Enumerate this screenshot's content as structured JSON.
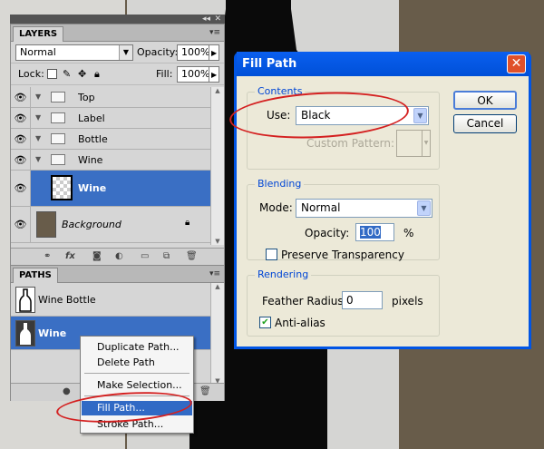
{
  "layers_panel": {
    "tab": "LAYERS",
    "blend_mode": "Normal",
    "opacity_label": "Opacity:",
    "opacity_value": "100%",
    "lock_label": "Lock:",
    "fill_label": "Fill:",
    "fill_value": "100%",
    "layers": [
      {
        "name": "Top",
        "kind": "group",
        "selected": false
      },
      {
        "name": "Label",
        "kind": "group",
        "selected": false
      },
      {
        "name": "Bottle",
        "kind": "group",
        "selected": false
      },
      {
        "name": "Wine",
        "kind": "group",
        "selected": false
      },
      {
        "name": "Wine",
        "kind": "layer",
        "selected": true
      },
      {
        "name": "Background",
        "kind": "background",
        "selected": false
      }
    ]
  },
  "paths_panel": {
    "tab": "PATHS",
    "paths": [
      {
        "name": "Wine Bottle",
        "selected": false
      },
      {
        "name": "Wine",
        "selected": true
      }
    ]
  },
  "context_menu": {
    "items": [
      "Duplicate Path...",
      "Delete Path",
      "Make Selection...",
      "Fill Path...",
      "Stroke Path..."
    ],
    "highlighted": "Fill Path..."
  },
  "dialog": {
    "title": "Fill Path",
    "contents_group": "Contents",
    "use_label": "Use:",
    "use_value": "Black",
    "custom_pattern_label": "Custom Pattern:",
    "blending_group": "Blending",
    "mode_label": "Mode:",
    "mode_value": "Normal",
    "opacity_label": "Opacity:",
    "opacity_value": "100",
    "opacity_unit": "%",
    "preserve_label": "Preserve Transparency",
    "preserve_checked": false,
    "rendering_group": "Rendering",
    "feather_label": "Feather Radius:",
    "feather_value": "0",
    "feather_unit": "pixels",
    "antialias_label": "Anti-alias",
    "antialias_checked": true,
    "ok": "OK",
    "cancel": "Cancel"
  },
  "colors": {
    "selection_blue": "#3a6fc4",
    "dialog_title_blue": "#0055e5",
    "highlight_ring": "#d42020",
    "canvas_brown": "#685c4a"
  }
}
